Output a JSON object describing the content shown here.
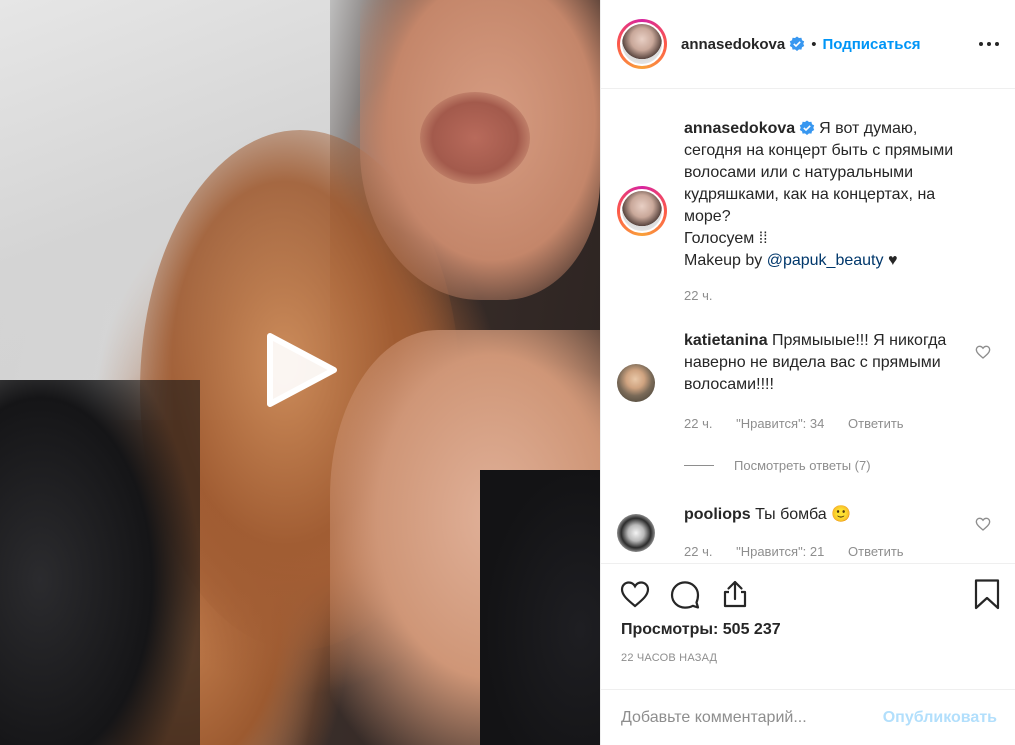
{
  "media": {
    "type": "video",
    "play_icon": "play-icon"
  },
  "header": {
    "username": "annasedokova",
    "separator": "•",
    "follow_label": "Подписаться",
    "more_icon": "more-horizontal-icon",
    "verified_color": "#3897f0"
  },
  "caption": {
    "username": "annasedokova",
    "text_lines": [
      "Я вот думаю,",
      "сегодня на концерт быть с прямыми",
      "волосами или с натуральными",
      "кудряшками, как на концертах, на",
      "море?",
      "Голосуем ⁞⁞"
    ],
    "makeup_prefix": "Makeup by ",
    "makeup_link": "@papuk_beauty",
    "makeup_suffix": " ♥",
    "time": "22 ч."
  },
  "comments": [
    {
      "username": "katietanina",
      "text": " Прямыыые!!! Я никогда наверно не видела вас с прямыми волосами!!!!",
      "time": "22 ч.",
      "likes": "\"Нравится\": 34",
      "reply": "Ответить",
      "view_replies": "Посмотреть ответы (7)"
    },
    {
      "username": "pooliops",
      "text": " Ты бомба 🙂",
      "time": "22 ч.",
      "likes": "\"Нравится\": 21",
      "reply": "Ответить"
    }
  ],
  "actions": {
    "icons": [
      "heart-icon",
      "comment-icon",
      "share-icon",
      "bookmark-icon"
    ]
  },
  "views": "Просмотры: 505 237",
  "timestamp": "22 ЧАСОВ НАЗАД",
  "add_comment": {
    "placeholder": "Добавьте комментарий...",
    "post_label": "Опубликовать"
  }
}
